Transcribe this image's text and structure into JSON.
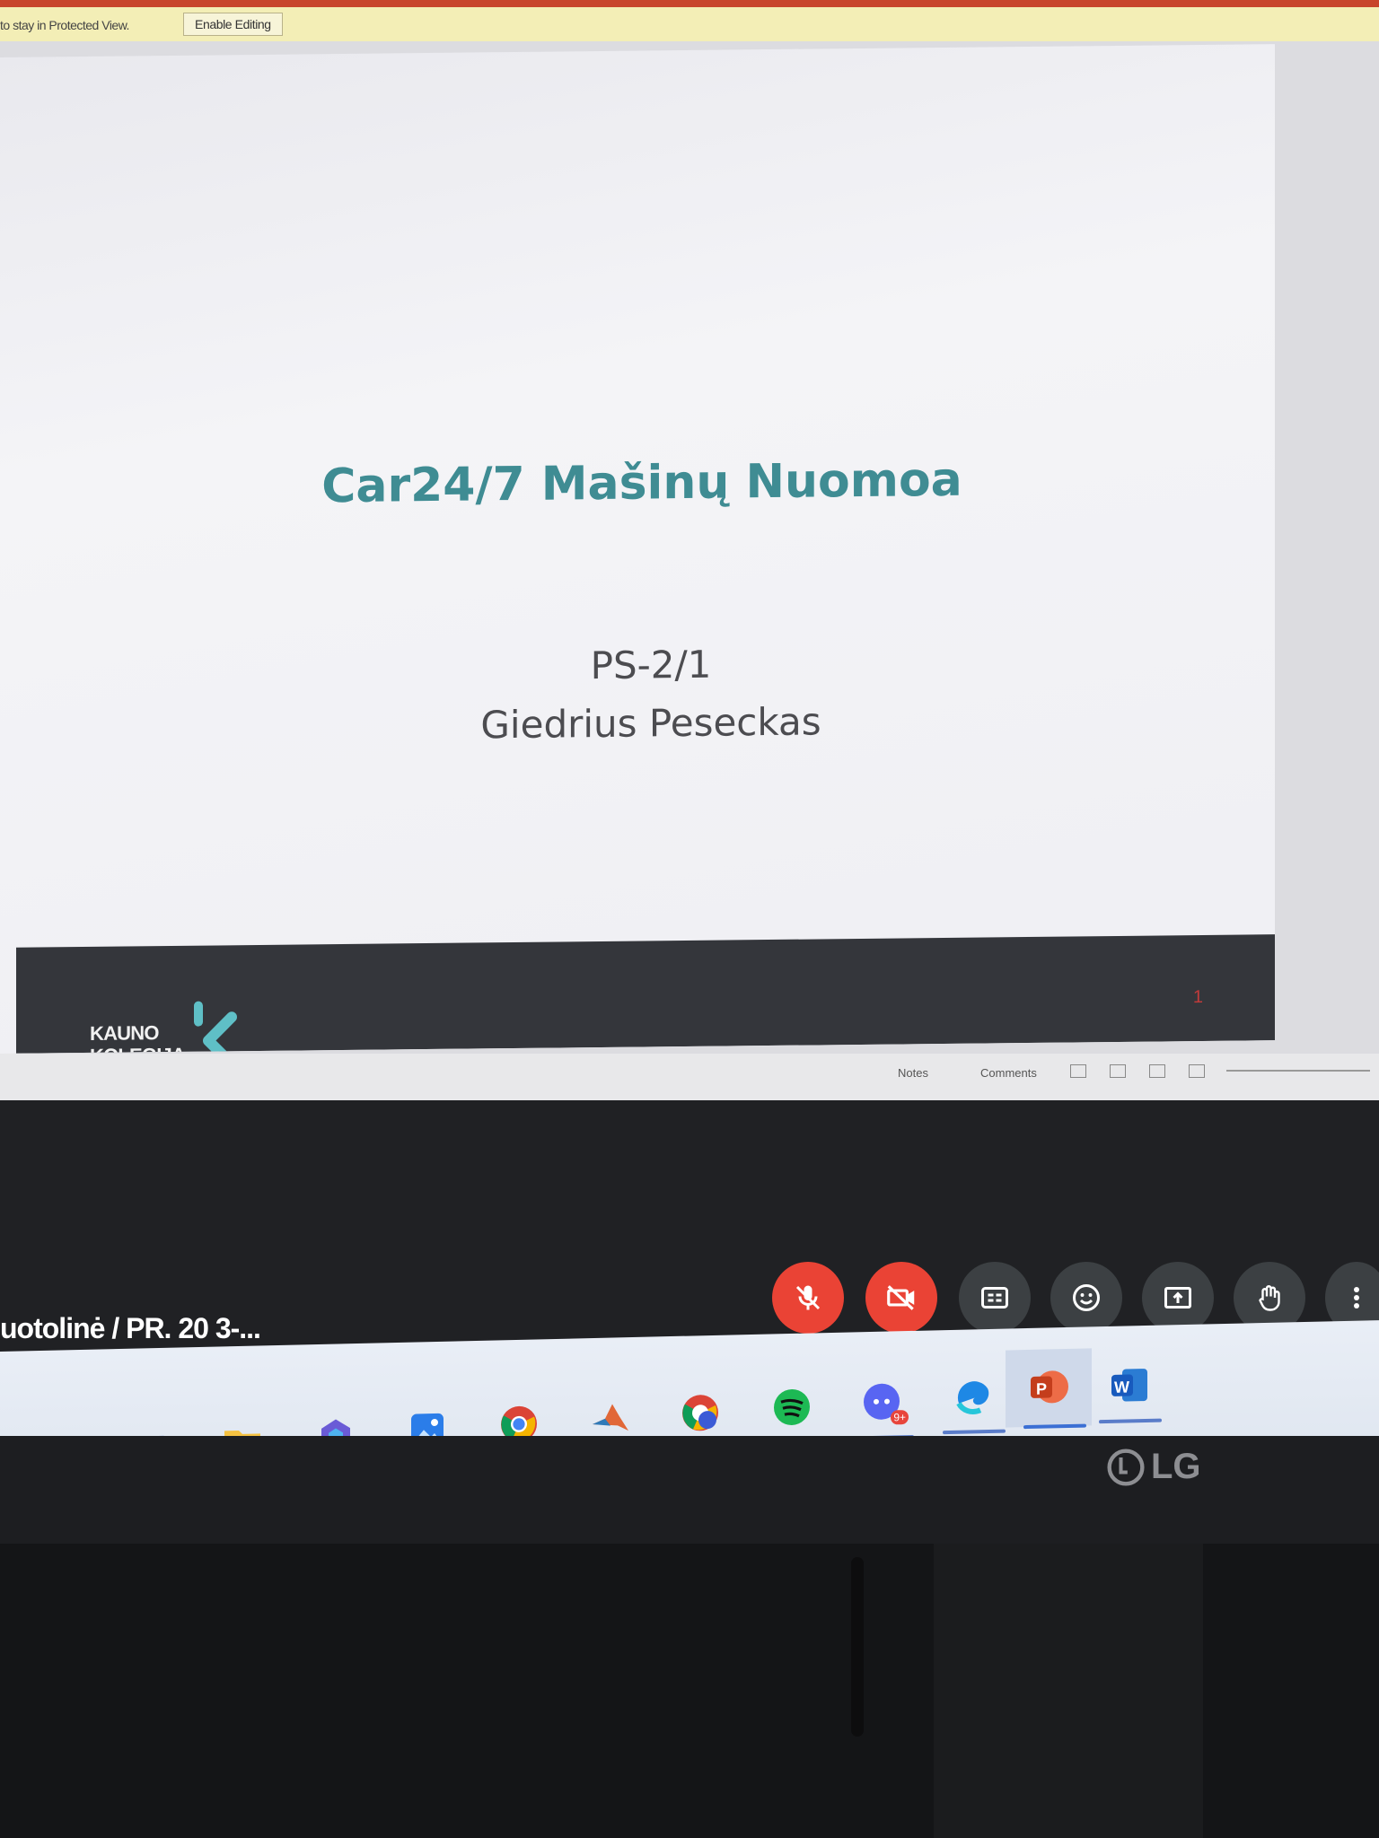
{
  "protected_view": {
    "message": "to stay in Protected View.",
    "enable_button": "Enable Editing"
  },
  "slide": {
    "title": "Car24/7 Mašinų Nuomoa",
    "subtitle_line1": "PS-2/1",
    "subtitle_line2": "Giedrius Peseckas",
    "logo_line1": "KAUNO",
    "logo_line2": "KOLEGIJA",
    "slide_number": "1"
  },
  "ppt_status": {
    "notes": "Notes",
    "comments": "Comments"
  },
  "meet": {
    "meeting_name": "uotolinė / PR. 20 3-...",
    "controls": [
      {
        "name": "mic-off",
        "state": "off"
      },
      {
        "name": "camera-off",
        "state": "off"
      },
      {
        "name": "captions",
        "state": "default"
      },
      {
        "name": "emoji",
        "state": "default"
      },
      {
        "name": "present",
        "state": "default"
      },
      {
        "name": "raise-hand",
        "state": "default"
      },
      {
        "name": "more",
        "state": "default"
      }
    ]
  },
  "taskbar": {
    "badge_count": "9+"
  },
  "monitor": {
    "brand": "LG"
  },
  "colors": {
    "accent_title": "#3f8c93",
    "meet_red": "#ea4335",
    "meet_dark": "#202124",
    "slide_footer": "#34363b"
  }
}
